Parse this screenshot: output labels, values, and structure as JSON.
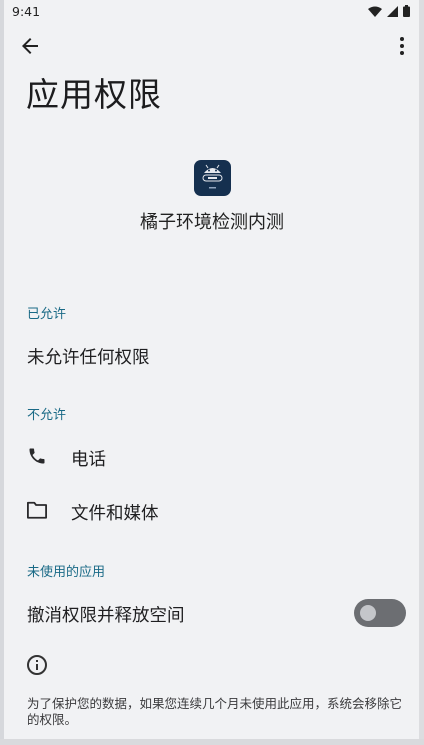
{
  "status_bar": {
    "time": "9:41"
  },
  "page": {
    "title": "应用权限"
  },
  "app": {
    "name": "橘子环境检测内测"
  },
  "sections": {
    "allowed": {
      "header": "已允许",
      "empty_text": "未允许任何权限"
    },
    "denied": {
      "header": "不允许",
      "items": [
        {
          "label": "电话",
          "icon": "phone-icon"
        },
        {
          "label": "文件和媒体",
          "icon": "folder-icon"
        }
      ]
    },
    "unused": {
      "header": "未使用的应用",
      "toggle_label": "撤消权限并释放空间",
      "toggle_on": false,
      "footnote": "为了保护您的数据，如果您连续几个月未使用此应用，系统会移除它的权限。"
    }
  },
  "colors": {
    "background": "#f1f2f4",
    "section_header": "#1a6a86",
    "toggle_off": "#6c6e72"
  }
}
